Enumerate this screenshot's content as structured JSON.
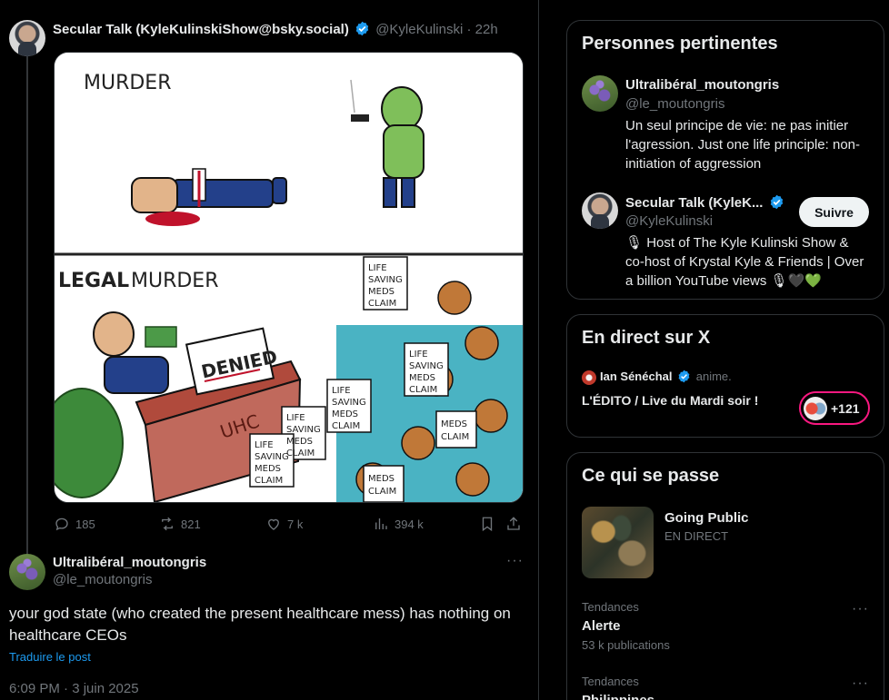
{
  "main_tweet": {
    "display_name": "Secular Talk (KyleKulinskiShow@bsky.social)",
    "handle": "@KyleKulinski",
    "sep": "·",
    "time": "22h",
    "image": {
      "top_caption": "MURDER",
      "bottom_caption_bold": "LEGAL",
      "bottom_caption": "MURDER",
      "sign": "DENIED",
      "desk_label": "UHC",
      "claim_words": [
        "LIFE",
        "SAVING",
        "MEDS",
        "CLAIM"
      ]
    },
    "stats": {
      "replies": "185",
      "reposts": "821",
      "likes": "7 k",
      "views": "394 k"
    }
  },
  "reply": {
    "display_name": "Ultralibéral_moutongris",
    "handle": "@le_moutongris",
    "text": "your god state (who created the present healthcare mess) has nothing on healthcare CEOs",
    "translate": "Traduire le post",
    "timestamp": "6:09 PM · 3 juin 2025"
  },
  "relevant_people": {
    "title": "Personnes pertinentes",
    "people": [
      {
        "name": "Ultralibéral_moutongris",
        "handle": "@le_moutongris",
        "bio_lines": [
          "Un seul principe de vie: ne pas initier",
          "l'agression. Just one life principle: non-",
          "initiation of aggression"
        ]
      },
      {
        "name": "Secular Talk (KyleK...",
        "handle": "@KyleKulinski",
        "follow_label": "Suivre",
        "bio_lines": [
          "🎙 Host of The Kyle Kulinski Show &",
          "co-host of Krystal Kyle & Friends | Over",
          "a billion YouTube views 🎙🖤💚"
        ]
      }
    ]
  },
  "live": {
    "title": "En direct sur X",
    "host": "Ian Sénéchal",
    "action": "anime.",
    "show": "L'ÉDITO / Live du Mardi soir !",
    "listeners": "+121"
  },
  "happening": {
    "title": "Ce qui se passe",
    "featured": {
      "title": "Going Public",
      "status": "EN DIRECT"
    },
    "trends": [
      {
        "label": "Tendances",
        "topic": "Alerte",
        "count": "53 k publications"
      },
      {
        "label": "Tendances",
        "topic": "Philippines",
        "count": ""
      }
    ]
  },
  "colors": {
    "background": "#000000",
    "text": "#e7e9ea",
    "muted": "#71767b",
    "border": "#2f3336",
    "link": "#1d9bf0",
    "verified": "#1d9bf0",
    "live_ring": "#f91880"
  },
  "icons": [
    "verified-badge-icon",
    "reply-icon",
    "repost-icon",
    "like-icon",
    "views-icon",
    "bookmark-icon",
    "share-icon",
    "more-icon"
  ]
}
